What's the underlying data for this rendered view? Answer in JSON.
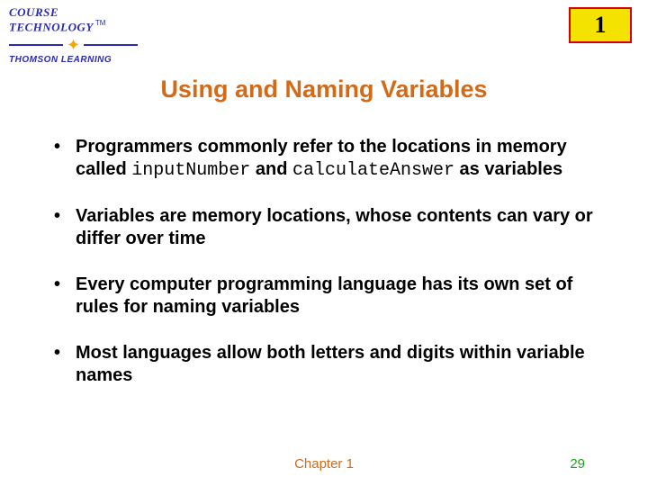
{
  "logo": {
    "line1": "COURSE",
    "line2": "TECHNOLOGY",
    "tm": "TM",
    "brand": "THOMSON LEARNING"
  },
  "chapter_badge": "1",
  "title": "Using and Naming Variables",
  "bullets": {
    "b1_pre": "Programmers commonly refer to the locations in memory called ",
    "b1_code1": "inputNumber",
    "b1_mid": " and ",
    "b1_code2": "calculateAnswer",
    "b1_post": " as variables",
    "b2": "Variables are memory locations, whose contents can vary or differ over time",
    "b3": "Every computer programming language has its own set of rules for naming variables",
    "b4": "Most languages allow both letters and digits within variable names"
  },
  "footer": {
    "chapter": "Chapter 1",
    "page": "29"
  }
}
